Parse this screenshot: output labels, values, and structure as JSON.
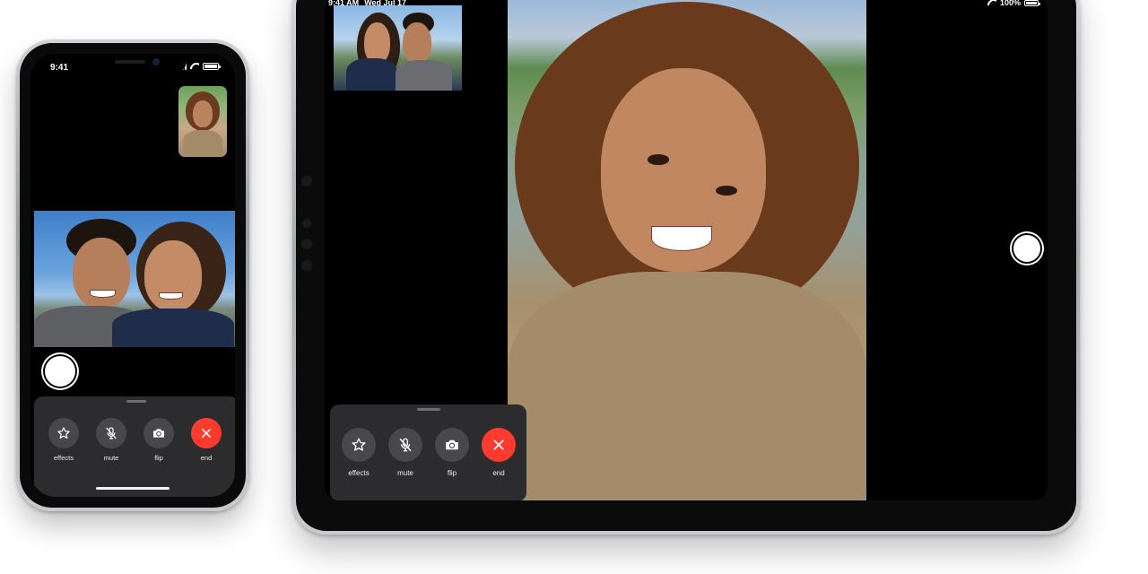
{
  "iphone": {
    "status": {
      "time": "9:41"
    },
    "controls": [
      {
        "id": "effects",
        "label": "effects",
        "icon": "star-icon"
      },
      {
        "id": "mute",
        "label": "mute",
        "icon": "mic-slash-icon"
      },
      {
        "id": "flip",
        "label": "flip",
        "icon": "camera-flip-icon"
      },
      {
        "id": "end",
        "label": "end",
        "icon": "close-icon"
      }
    ]
  },
  "ipad": {
    "status": {
      "time": "9:41 AM",
      "date": "Wed Jul 17",
      "battery": "100%"
    },
    "controls": [
      {
        "id": "effects",
        "label": "effects",
        "icon": "star-icon"
      },
      {
        "id": "mute",
        "label": "mute",
        "icon": "mic-slash-icon"
      },
      {
        "id": "flip",
        "label": "flip",
        "icon": "camera-flip-icon"
      },
      {
        "id": "end",
        "label": "end",
        "icon": "close-icon"
      }
    ]
  },
  "colors": {
    "end_button": "#ff3b30",
    "control_button": "#48484a",
    "panel": "#2c2c2e"
  }
}
